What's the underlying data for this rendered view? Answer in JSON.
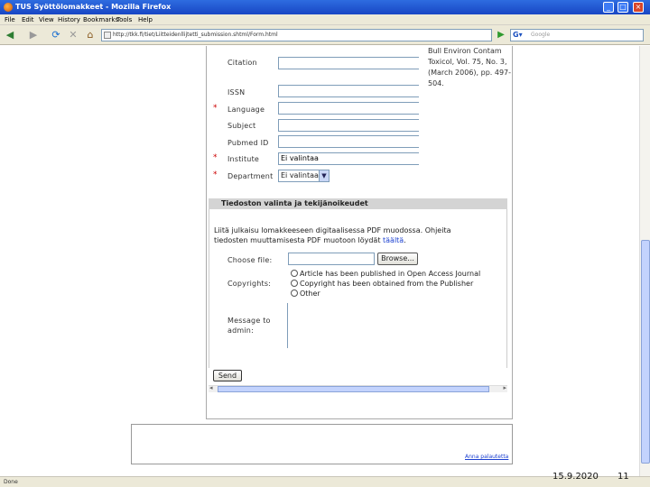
{
  "window": {
    "title": "TUS Syöttölomakkeet - Mozilla Firefox",
    "minimize": "_",
    "maximize": "□",
    "close": "×"
  },
  "menu": [
    "File",
    "Edit",
    "View",
    "History",
    "Bookmarks",
    "Tools",
    "Help"
  ],
  "nav": {
    "back_icon": "◀",
    "forward_icon": "▶",
    "reload_icon": "⟳",
    "stop_icon": "✕",
    "home_icon": "⌂",
    "url": "http://tkk.fi/tiet/Liitteidenllijtetti_submission.shtml/Form.html",
    "go_icon": "▶",
    "search_engine": "G▾",
    "search_placeholder": "Google"
  },
  "form": {
    "citation_label": "Citation",
    "issn_label": "ISSN",
    "language_label": "Language",
    "subject_label": "Subject",
    "pubmed_label": "Pubmed ID",
    "institute_label": "Institute",
    "institute_value": "Ei valintaa",
    "department_label": "Department",
    "department_value": "Ei valintaa",
    "required_mark": "*",
    "citation_note": "Bull Environ Contam Toxicol, Vol. 75, No. 3, (March 2006), pp. 497-504."
  },
  "upload": {
    "section_title": "Tiedoston valinta ja tekijänoikeudet",
    "intro": "Liitä julkaisu lomakkeeseen digitaalisessa PDF muodossa. Ohjeita tiedosten muuttamisesta PDF muotoon löydät ",
    "intro_link": "täältä",
    "intro_end": ".",
    "choose_file_label": "Choose file:",
    "browse_label": "Browse...",
    "copyrights_label": "Copyrights:",
    "radio_options": [
      "Article has been published in Open Access Journal",
      "Copyright has been obtained from the Publisher",
      "Other"
    ],
    "message_label_1": "Message to",
    "message_label_2": "admin:",
    "send_label": "Send"
  },
  "lower": {
    "link_text": "Anna palautetta"
  },
  "status": {
    "text": "Done"
  },
  "slide": {
    "date": "15.9.2020",
    "page": "11"
  }
}
